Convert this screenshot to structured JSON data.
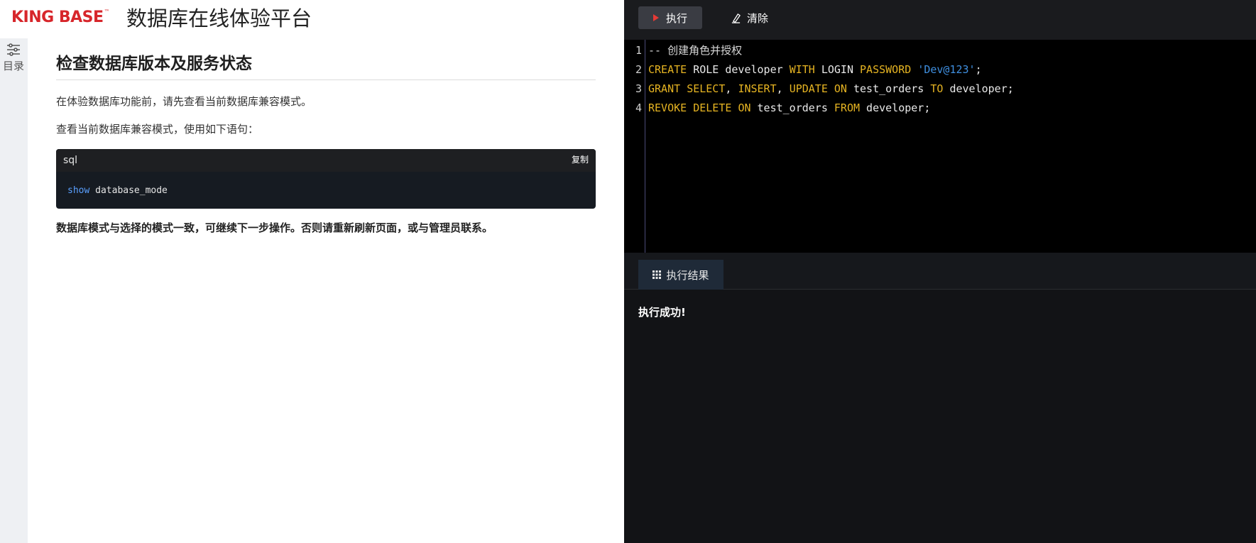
{
  "header": {
    "logo_text": "KING BASE",
    "logo_tm": "™",
    "platform_title": "数据库在线体验平台"
  },
  "sidebar": {
    "toc_label": "目录",
    "toc_icon": "sliders-icon"
  },
  "doc": {
    "title": "检查数据库版本及服务状态",
    "para1": "在体验数据库功能前，请先查看当前数据库兼容模式。",
    "para2": "查看当前数据库兼容模式，使用如下语句：",
    "code_lang": "sql",
    "copy_label": "复制",
    "code_keyword": "show",
    "code_rest": " database_mode",
    "para3": "数据库模式与选择的模式一致，可继续下一步操作。否则请重新刷新页面，或与管理员联系。"
  },
  "toolbar": {
    "run_label": "执行",
    "clear_label": "清除"
  },
  "editor": {
    "line_numbers": [
      "1",
      "2",
      "3",
      "4"
    ],
    "lines": {
      "l1_comment": "-- 创建角色并授权",
      "l2_k1": "CREATE",
      "l2_t1": " ROLE developer ",
      "l2_k2": "WITH",
      "l2_t2": " LOGIN ",
      "l2_k3": "PASSWORD",
      "l2_t3": " ",
      "l2_s1": "'Dev@123'",
      "l2_t4": ";",
      "l3_k1": "GRANT",
      "l3_t1": " ",
      "l3_k2": "SELECT",
      "l3_t2": ", ",
      "l3_k3": "INSERT",
      "l3_t3": ", ",
      "l3_k4": "UPDATE",
      "l3_t4": " ",
      "l3_k5": "ON",
      "l3_t5": " test_orders ",
      "l3_k6": "TO",
      "l3_t6": " developer;",
      "l4_k1": "REVOKE",
      "l4_t1": " ",
      "l4_k2": "DELETE",
      "l4_t2": " ",
      "l4_k3": "ON",
      "l4_t3": " test_orders ",
      "l4_k4": "FROM",
      "l4_t4": " developer;"
    }
  },
  "results": {
    "tab_label": "执行结果",
    "message": "执行成功!"
  },
  "colors": {
    "brand_red": "#d7262b",
    "keyword": "#e6b422",
    "string": "#3f8fe0"
  }
}
